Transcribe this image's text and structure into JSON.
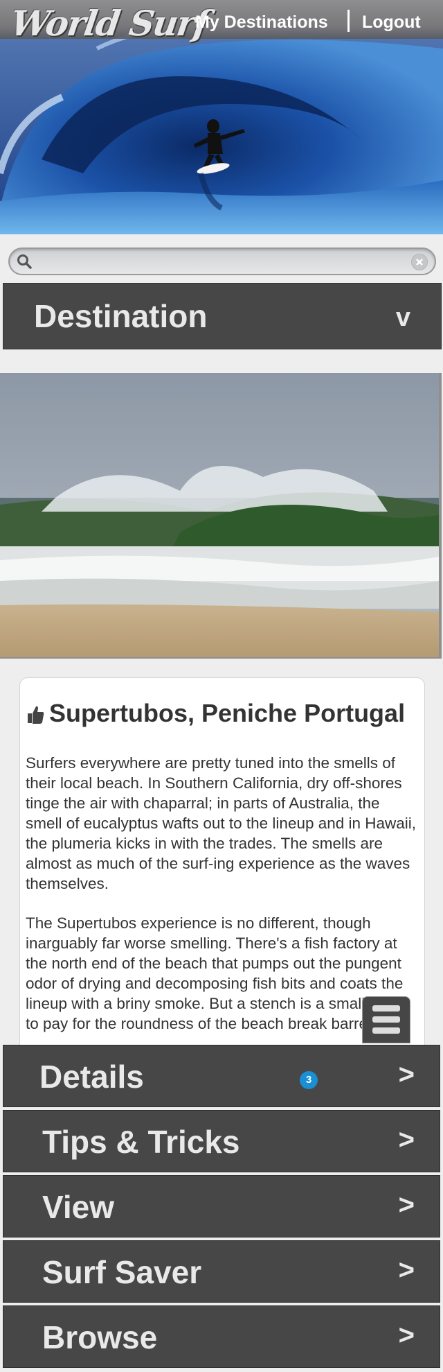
{
  "header": {
    "logo_text": "World Surf",
    "nav": {
      "my_destinations": "My Destinations",
      "logout": "Logout"
    }
  },
  "search": {
    "placeholder": "",
    "value": ""
  },
  "destination_bar": {
    "title": "Destination",
    "chevron": "v"
  },
  "article": {
    "title": "Supertubos, Peniche Portugal",
    "paragraphs": [
      "Surfers everywhere are pretty tuned into the smells of their local beach. In Southern California, dry off-shores tinge the air with chaparral; in parts of Australia, the smell of eucalyptus wafts out to the lineup and in Hawaii, the plumeria kicks in with the trades. The smells are almost as much of the surf-ing experience as the waves themselves.",
      "The Supertubos experience is no different, though inarguably far worse smelling. There's a fish factory at the north end of the beach that pumps out the pungent odor of drying and decomposing fish bits and coats the lineup with a briny smoke. But a stench is a small price to pay for the roundness of the beach break barrels."
    ]
  },
  "menu": {
    "items": [
      {
        "label": "Details",
        "arrow": ">",
        "badge": "3"
      },
      {
        "label": "Tips & Tricks",
        "arrow": ">"
      },
      {
        "label": "View",
        "arrow": ">"
      },
      {
        "label": "Surf Saver",
        "arrow": ">"
      },
      {
        "label": "Browse",
        "arrow": ">"
      }
    ]
  }
}
